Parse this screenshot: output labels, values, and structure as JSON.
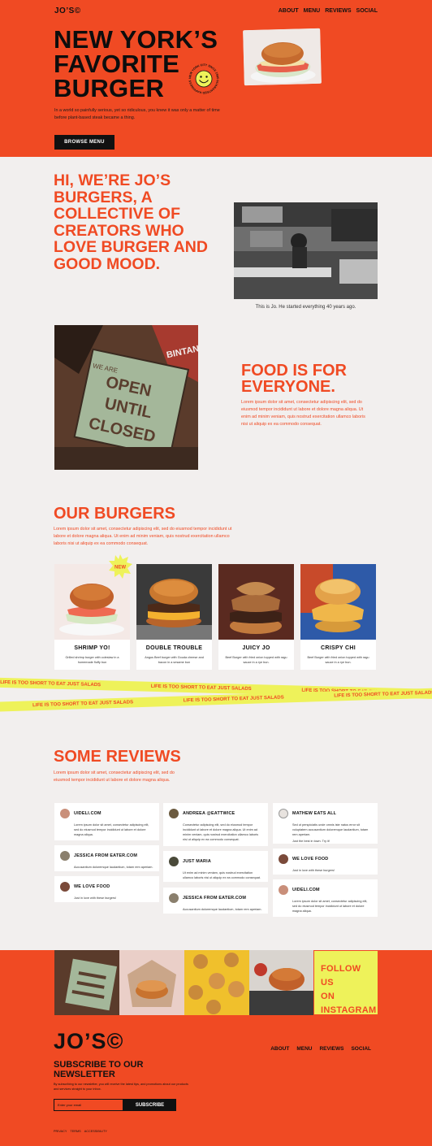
{
  "header": {
    "logo": "JO’S©",
    "nav": [
      "ABOUT",
      "MENU",
      "REVIEWS",
      "SOCIAL"
    ]
  },
  "hero": {
    "title": "NEW YORK’S FAVORITE BURGER",
    "text": "In a world so painfully serious, yet so ridiculous, you knew it was only a matter of time before plant-based steak became a thing.",
    "button": "BROWSE MENU",
    "stamp_text": "NEW YORK CITY SINCE 1985 GUARANTEED HAPPINESS"
  },
  "intro": {
    "title": "HI, WE’RE JO’S BURGERS, A COLLECTIVE OF CREATORS WHO LOVE BURGER AND GOOD MOOD.",
    "caption": "This is Jo. He started everything 40 years ago."
  },
  "food": {
    "sign_words": [
      "WE ARE",
      "OPEN",
      "UNTIL",
      "CLOSED"
    ],
    "sign_beer": "BINTANG Pilsener",
    "title": "FOOD IS FOR EVERYONE.",
    "text": "Lorem ipsum dolor sit amet, consectetur adipiscing elit, sed do eiusmod tempor incididunt ut labore et dolore magna aliqua. Ut enim ad minim veniam, quis nostrud exercitation ullamco laboris nisi ut aliquip ex ea commodo consequat."
  },
  "burgers": {
    "title": "OUR BURGERS",
    "text": "Lorem ipsum dolor sit amet, consectetur adipiscing elit, sed do eiusmod tempor incididunt ut labore et dolore magna aliqua. Ut enim ad minim veniam, quis nostrud exercitation ullamco laboris nisi ut aliquip ex ea commodo consequat.",
    "badge": "NEW",
    "items": [
      {
        "name": "SHRIMP YO!",
        "desc": "Grilled shrimp burger with coleslaw in a homemade fluffy bun"
      },
      {
        "name": "DOUBLE TROUBLE",
        "desc": "Angus Beef burger with Gouda cheese and bacon in a sesame bun"
      },
      {
        "name": "JUICY JO",
        "desc": "Beef Burger with fried onion topped with ragu sauce in a rye bun."
      },
      {
        "name": "CRISPY CHI",
        "desc": "Beef Burger with fried onion topped with ragu sauce in a rye bun."
      }
    ]
  },
  "tapes": {
    "text": "LIFE IS TOO SHORT TO EAT JUST SALADS"
  },
  "reviews": {
    "title": "SOME REVIEWS",
    "text": "Lorem ipsum dolor sit amet, consectetur adipiscing elit, sed do eiusmod tempor incididunt ut labore et dolore magna aliqua.",
    "items": [
      {
        "name": "UIDELI.COM",
        "text": "Lorem ipsum dolor sit amet, consectetur adipiscing elit, sed do eiusmod tempor incididunt ut labore et dolore magna aliqua."
      },
      {
        "name": "JESSICA FROM EATER.COM",
        "text": "Accusantium doloremque laudantium, totam rem aperiam."
      },
      {
        "name": "WE LOVE FOOD",
        "text": "Just in love with these burgers!"
      },
      {
        "name": "ANDREEA @EATTWICE",
        "text": "Consectetur adipiscing elit, sed do eiusmod tempor incididunt ut labore et dolore magna aliqua. Ut enim ad minim veniam, quis nostrud exercitation ullamco laboris nisi ut aliquip ex ea commodo consequat."
      },
      {
        "name": "JUST MARIA",
        "text": "Ut enim ad minim veniam, quis nostrud exercitation ullamco laboris nisi ut aliquip ex ea commodo consequat."
      },
      {
        "name": "JESSICA FROM EATER.COM",
        "text": "Accusantium doloremque laudantium, totam rem aperiam."
      },
      {
        "name": "MATHEW EATS ALL",
        "text": "Sed ut perspiciatis unde omnis iste natus error sit voluptatem accusantium doloremque laudantium, totam rem aperiam."
      },
      {
        "name": "WE LOVE FOOD",
        "text": "Just in love with these burgers!"
      },
      {
        "name": "UIDELI.COM",
        "text": "Lorem ipsum dolor sit amet, consectetur adipiscing elit, sed do eiusmod tempor incididunt ut labore et dolore magna aliqua."
      }
    ],
    "extra": "Just the best in town. Try it!"
  },
  "footer": {
    "follow": "FOLLOW US ON INSTAGRAM",
    "follow_lines": [
      "FOLLOW US",
      "ON",
      "INSTAGRAM"
    ],
    "logo": "JO’S©",
    "nav": [
      "ABOUT",
      "MENU",
      "REVIEWS",
      "SOCIAL"
    ],
    "subscribe_title": "SUBSCRIBE TO OUR NEWSLETTER",
    "subscribe_text": "By subscribing to our newsletter, you will receive the latest tips, and promotions about our products and services straight to your inbox.",
    "email_placeholder": "Enter your email",
    "subscribe_button": "SUBSCRIBE",
    "legal": [
      "PRIVACY",
      "TERMS",
      "ACCESSIBILITY"
    ]
  },
  "colors": {
    "brand_orange": "#f04a23",
    "tape_yellow": "#eef25a",
    "background": "#f2efee",
    "ink": "#111111"
  }
}
